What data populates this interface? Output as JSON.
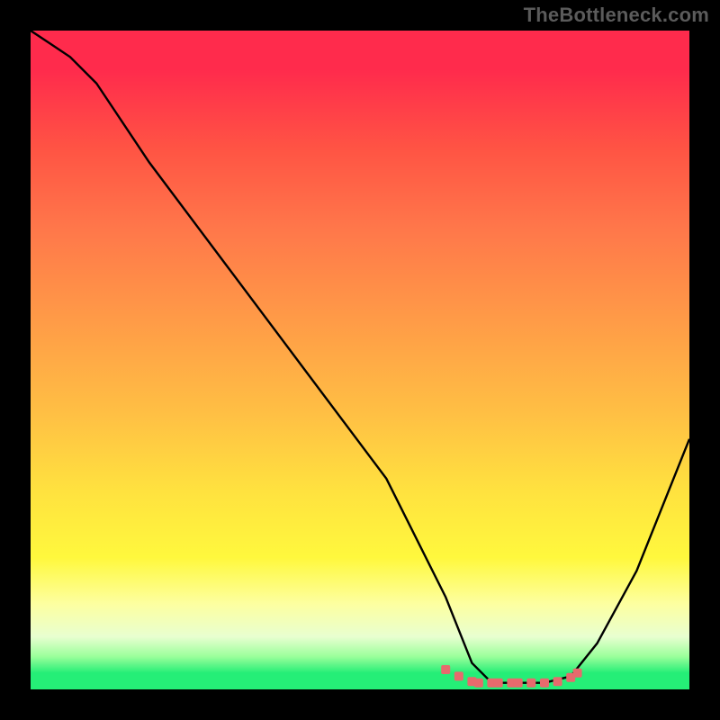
{
  "watermark": "TheBottleneck.com",
  "colors": {
    "curve": "#000000",
    "marker": "#e76a6d",
    "background_black": "#000000"
  },
  "chart_data": {
    "type": "line",
    "title": "",
    "xlabel": "",
    "ylabel": "",
    "xlim": [
      0,
      100
    ],
    "ylim": [
      0,
      100
    ],
    "grid": false,
    "legend": false,
    "note": "Axes are unlabeled in source image; values are estimated from pixel geometry on a 0-100 normalized scale. Curve: high at left, falls to a flat minimum near x≈67-82, rises toward right. Markers: small red squares clustered along the flat bottom (optimal region).",
    "series": [
      {
        "name": "bottleneck-curve",
        "x": [
          0,
          3,
          6,
          10,
          18,
          30,
          42,
          54,
          63,
          67,
          70,
          74,
          78,
          82,
          86,
          92,
          100
        ],
        "y": [
          100,
          98,
          96,
          92,
          80,
          64,
          48,
          32,
          14,
          4,
          1,
          1,
          1,
          2,
          7,
          18,
          38
        ]
      }
    ],
    "markers": {
      "name": "optimal-points",
      "x": [
        63,
        65,
        67,
        68,
        70,
        71,
        73,
        74,
        76,
        78,
        80,
        82,
        83
      ],
      "y": [
        3,
        2,
        1.2,
        1.0,
        1.0,
        1.0,
        1.0,
        1.0,
        1.0,
        1.0,
        1.2,
        1.8,
        2.5
      ]
    }
  }
}
